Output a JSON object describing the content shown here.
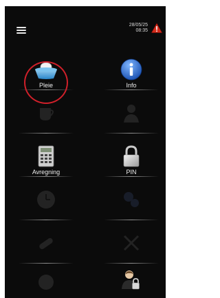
{
  "status": {
    "date": "28/05/25",
    "time": "08:35"
  },
  "tiles": [
    {
      "label": "Pleie",
      "icon": "care-basin-icon"
    },
    {
      "label": "Info",
      "icon": "info-icon"
    },
    {
      "label": "",
      "icon": "cup-icon"
    },
    {
      "label": "",
      "icon": "nurse-icon"
    },
    {
      "label": "Avregning",
      "icon": "calculator-icon"
    },
    {
      "label": "PIN",
      "icon": "lock-icon"
    },
    {
      "label": "",
      "icon": "clock-icon"
    },
    {
      "label": "",
      "icon": "gears-icon"
    },
    {
      "label": "",
      "icon": "sleeve-icon"
    },
    {
      "label": "",
      "icon": "tools-icon"
    },
    {
      "label": "",
      "icon": "face-icon"
    },
    {
      "label": "",
      "icon": "user-lock-icon"
    }
  ],
  "colors": {
    "background": "#0b0b0b",
    "highlight": "#d0202a",
    "info_blue": "#1c63c9",
    "warning": "#d42a1a"
  }
}
